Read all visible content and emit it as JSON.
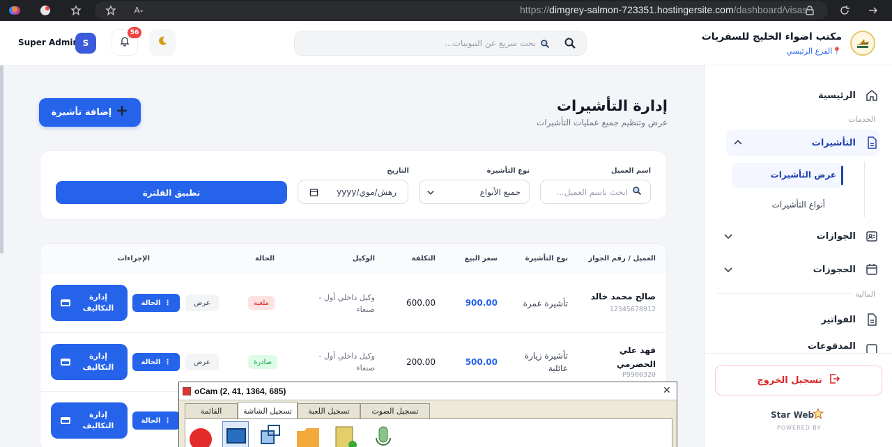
{
  "browser": {
    "url_prefix": "https://",
    "url_host": "dimgrey-salmon-723351.hostingersite.com",
    "url_path": "/dashboard/visas"
  },
  "header": {
    "user_name": "Super Admin",
    "avatar_letter": "S",
    "notification_count": "56",
    "search_placeholder": "بحث سريع عن التبويبات...",
    "brand_name": "مكتب اضواء الخليج للسفريات",
    "branch": "الفرع الرئيسي"
  },
  "sidebar": {
    "home": "الرئيسية",
    "section_services": "الخدمات",
    "visas": "التأشيرات",
    "visas_view": "عرض التأشيرات",
    "visa_types": "أنواع التأشيرات",
    "passports": "الجوازات",
    "bookings": "الحجوزات",
    "section_finance": "المالية",
    "invoices": "الفواتير",
    "payments": "المدفوعات",
    "logout": "تسجيل الخروج",
    "footer_brand": "Star Web",
    "footer_powered": "POWERED BY"
  },
  "page": {
    "title": "إدارة التأشيرات",
    "subtitle": "عرض وتنظيم جميع عمليات التأشيرات",
    "add_button": "إضافة تأشيرة"
  },
  "filters": {
    "client_label": "اسم العميل",
    "client_placeholder": "ابحث باسم العميل...",
    "type_label": "نوع التأشيرة",
    "type_value": "جميع الأنواع",
    "date_label": "التاريخ",
    "date_placeholder": "yyyy/رهش/موي",
    "apply_button": "تطبيق الفلترة"
  },
  "table": {
    "headers": [
      "العميل / رقم الجواز",
      "نوع التأشيرة",
      "سعر البيع",
      "التكلفة",
      "الوكيل",
      "الحالة",
      "الإجراءات"
    ],
    "rows": [
      {
        "name": "صالح محمد خالد",
        "passport": "12345678912",
        "type": "تأشيرة عمرة",
        "sale": "900.00",
        "cost": "600.00",
        "agent": "وكيل داخلي أول - صنعاء",
        "status": "ملغية"
      },
      {
        "name": "فهد علي الحضرمي",
        "passport": "P9900320",
        "type": "تأشيرة زيارة عائلية",
        "sale": "500.00",
        "cost": "200.00",
        "agent": "وكيل داخلي أول - صنعاء",
        "status": "صادرة"
      }
    ],
    "view_label": "عرض",
    "status_button": "الحالة",
    "costs_button": "إدارة التكاليف"
  },
  "ocam": {
    "title": "oCam (2, 41, 1364, 685)",
    "tabs": [
      "القائمة",
      "تسجيل الشاشة",
      "تسجيل اللعبة",
      "تسجيل الصوت"
    ]
  },
  "colors": {
    "primary": "#2563eb",
    "danger": "#dc2626",
    "success": "#16a34a"
  }
}
